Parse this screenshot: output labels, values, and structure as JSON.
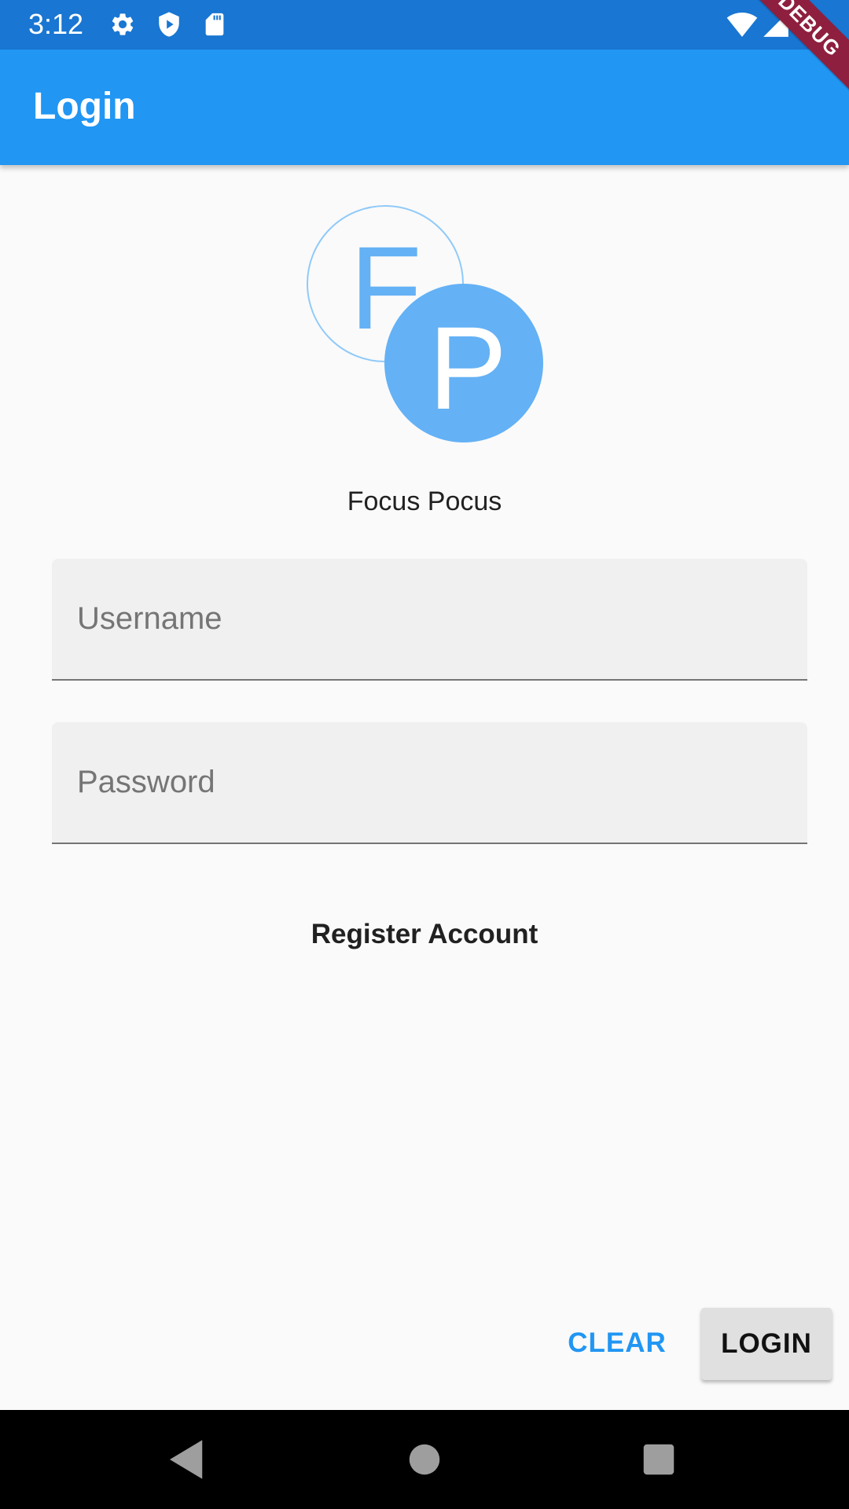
{
  "status_bar": {
    "time": "3:12",
    "icons": [
      "settings-icon",
      "shield-play-icon",
      "sd-card-icon",
      "wifi-icon",
      "signal-icon",
      "battery-icon"
    ]
  },
  "debug_banner": {
    "label": "DEBUG"
  },
  "app_bar": {
    "title": "Login"
  },
  "logo": {
    "letter_1": "F",
    "letter_2": "P"
  },
  "brand": {
    "name": "Focus Pocus"
  },
  "form": {
    "username": {
      "placeholder": "Username",
      "value": ""
    },
    "password": {
      "placeholder": "Password",
      "value": ""
    },
    "register_label": "Register Account"
  },
  "actions": {
    "clear_label": "CLEAR",
    "login_label": "LOGIN"
  },
  "nav_bar": {
    "icons": [
      "back-icon",
      "home-icon",
      "recents-icon"
    ]
  },
  "colors": {
    "primary": "#2196f3",
    "primary_dark": "#1976d2",
    "logo_fill": "#64b1f5",
    "debug_banner": "#8e1f3f",
    "background": "#fafafa"
  }
}
